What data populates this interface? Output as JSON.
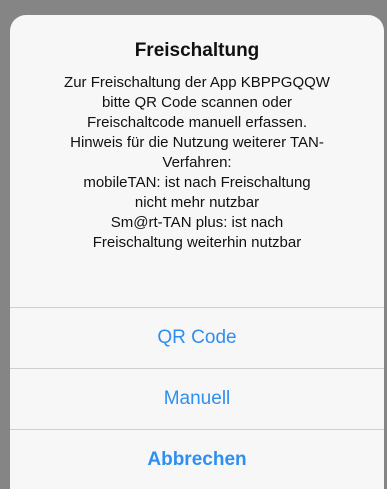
{
  "alert": {
    "title": "Freischaltung",
    "message_lines": [
      "Zur Freischaltung der App KBPPGQQW",
      "bitte QR Code scannen oder",
      "Freischaltcode manuell erfassen.",
      "Hinweis für die Nutzung weiterer TAN-",
      "Verfahren:",
      "mobileTAN: ist nach Freischaltung",
      "nicht mehr nutzbar",
      "Sm@rt-TAN plus: ist nach",
      "Freischaltung weiterhin nutzbar"
    ],
    "actions": {
      "qr_code": "QR Code",
      "manual": "Manuell",
      "cancel": "Abbrechen"
    }
  },
  "colors": {
    "accent": "#2f8ff0",
    "alert_background": "#f7f7f7",
    "dim_overlay": "#858585"
  }
}
